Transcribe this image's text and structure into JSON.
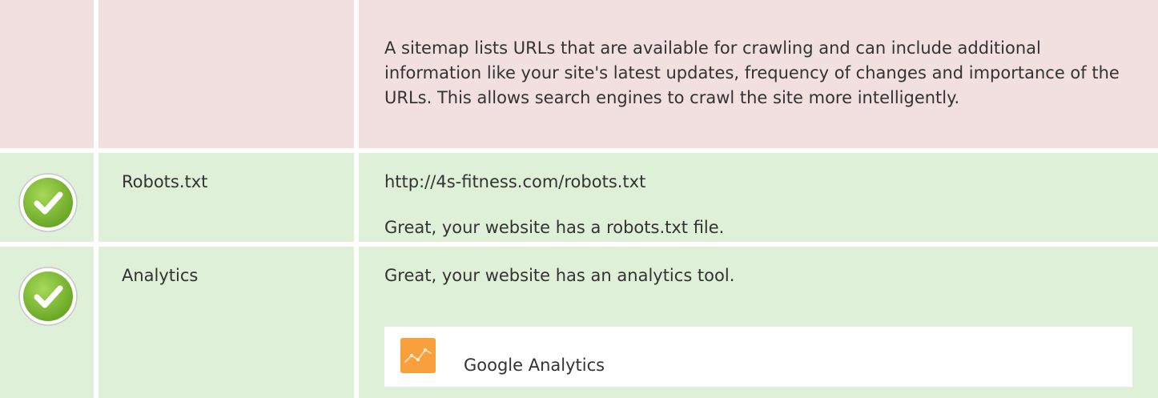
{
  "rows": {
    "sitemap": {
      "description": "A sitemap lists URLs that are available for crawling and can include additional information like your site's latest updates, frequency of changes and importance of the URLs. This allows search engines to crawl the site more intelligently."
    },
    "robots": {
      "label": "Robots.txt",
      "url": "http://4s-fitness.com/robots.txt",
      "message": "Great, your website has a robots.txt file."
    },
    "analytics": {
      "label": "Analytics",
      "message": "Great, your website has an analytics tool.",
      "tool_name": "Google Analytics"
    }
  },
  "colors": {
    "warning_background": "#f2dfe0",
    "success_background": "#dff0d8",
    "check_green": "#7cb82f",
    "analytics_orange": "#f7a03c"
  },
  "icons": {
    "success": "check-circle-icon",
    "tool": "google-analytics-icon"
  }
}
